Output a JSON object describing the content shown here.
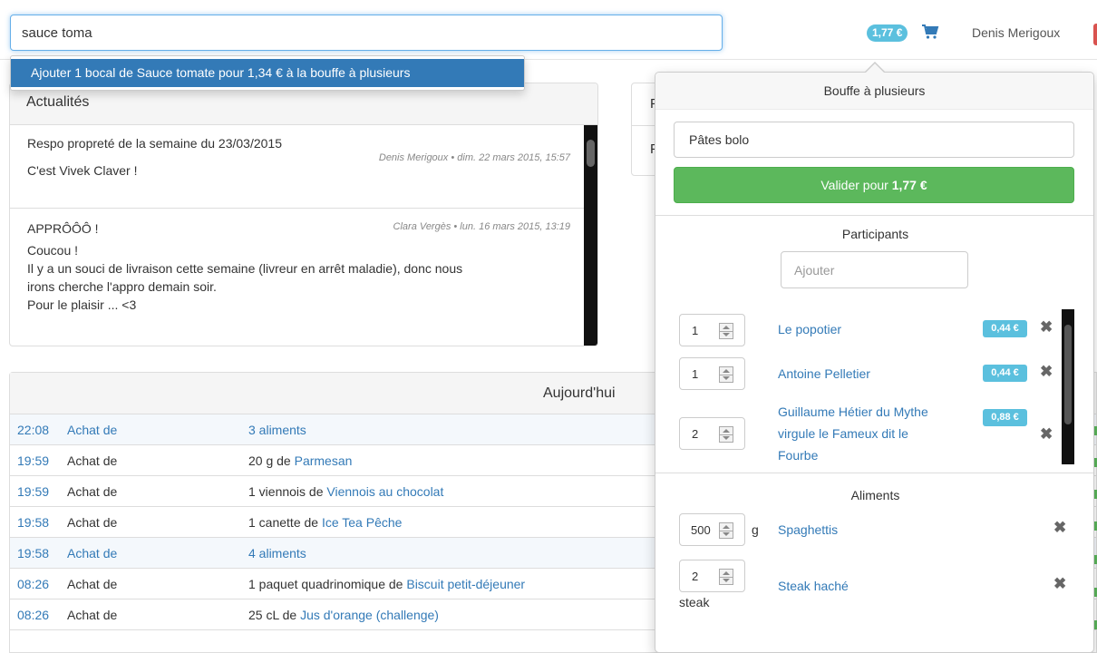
{
  "search": {
    "value": "sauce toma"
  },
  "topbar": {
    "balance": "1,77 €",
    "cart_icon": "shopping-cart-icon",
    "user": "Denis Merigoux"
  },
  "autocomplete": {
    "item": "Ajouter 1 bocal de Sauce tomate pour 1,34 € à la bouffe à plusieurs"
  },
  "news": {
    "heading": "Actualités",
    "items": [
      {
        "title": "Respo propreté de la semaine du 23/03/2015",
        "meta": "Denis Merigoux • dim. 22 mars 2015, 15:57",
        "body": [
          "C'est Vivek Claver !"
        ]
      },
      {
        "title": "APPRÔÔÔ !",
        "meta": "Clara Vergès • lun. 16 mars 2015, 13:19",
        "body": [
          "Coucou !",
          "Il y a un souci de livraison cette semaine (livreur en arrêt maladie), donc nous",
          "irons cherche l'appro demain soir.",
          "Pour le plaisir ... <3"
        ]
      }
    ]
  },
  "second_panel": {
    "labels": [
      "F",
      "F"
    ]
  },
  "today": {
    "heading": "Aujourd'hui",
    "rows": [
      {
        "time": "22:08",
        "verb": "Achat de",
        "prefix": "",
        "item": "3 aliments"
      },
      {
        "time": "19:59",
        "verb": "Achat de",
        "prefix": "20 g de ",
        "item": "Parmesan"
      },
      {
        "time": "19:59",
        "verb": "Achat de",
        "prefix": "1 viennois de ",
        "item": "Viennois au chocolat"
      },
      {
        "time": "19:58",
        "verb": "Achat de",
        "prefix": "1 canette de ",
        "item": "Ice Tea Pêche"
      },
      {
        "time": "19:58",
        "verb": "Achat de",
        "prefix": "",
        "item": "4 aliments"
      },
      {
        "time": "08:26",
        "verb": "Achat de",
        "prefix": "1 paquet quadrinomique de ",
        "item": "Biscuit petit-déjeuner"
      },
      {
        "time": "08:26",
        "verb": "Achat de",
        "prefix": "25 cL de ",
        "item": "Jus d'orange (challenge)"
      }
    ]
  },
  "popover": {
    "title": "Bouffe à plusieurs",
    "meal_name": "Pâtes bolo",
    "validate_prefix": "Valider pour ",
    "validate_amount": "1,77 €",
    "participants_title": "Participants",
    "add_placeholder": "Ajouter",
    "participants": [
      {
        "qty": "1",
        "name_lines": [
          "Le popotier"
        ],
        "amount": "0,44 €"
      },
      {
        "qty": "1",
        "name_lines": [
          "Antoine Pelletier"
        ],
        "amount": "0,44 €"
      },
      {
        "qty": "2",
        "name_lines": [
          "Guillaume Hétier du Mythe",
          "virgule le Fameux dit le",
          "Fourbe"
        ],
        "amount": "0,88 €"
      }
    ],
    "aliments_title": "Aliments",
    "aliments": [
      {
        "qty": "500",
        "unit": "g",
        "name": "Spaghettis"
      },
      {
        "qty": "2",
        "unit": "steak",
        "name": "Steak haché"
      }
    ],
    "remove_icon": "remove-x-icon"
  }
}
